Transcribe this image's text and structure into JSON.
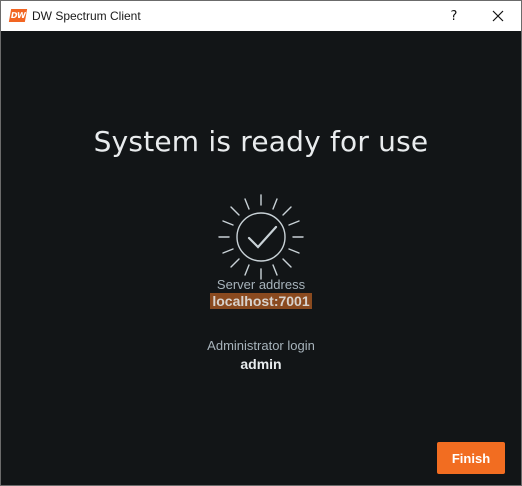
{
  "window": {
    "logo_text": "DW",
    "title": "DW Spectrum Client",
    "help_label": "?",
    "close_label": "×"
  },
  "main": {
    "headline": "System is ready for use",
    "server_address_label": "Server address",
    "server_address_value": "localhost:7001",
    "admin_login_label": "Administrator login",
    "admin_login_value": "admin",
    "finish_label": "Finish"
  },
  "icons": {
    "ready": "checkmark-circle-rays-icon",
    "close": "close-icon",
    "help": "help-icon"
  },
  "colors": {
    "background": "#121517",
    "accent": "#f26d21",
    "selection": "#8a4a1f",
    "text": "#e9ecee",
    "muted_text": "#a7b3bb"
  }
}
